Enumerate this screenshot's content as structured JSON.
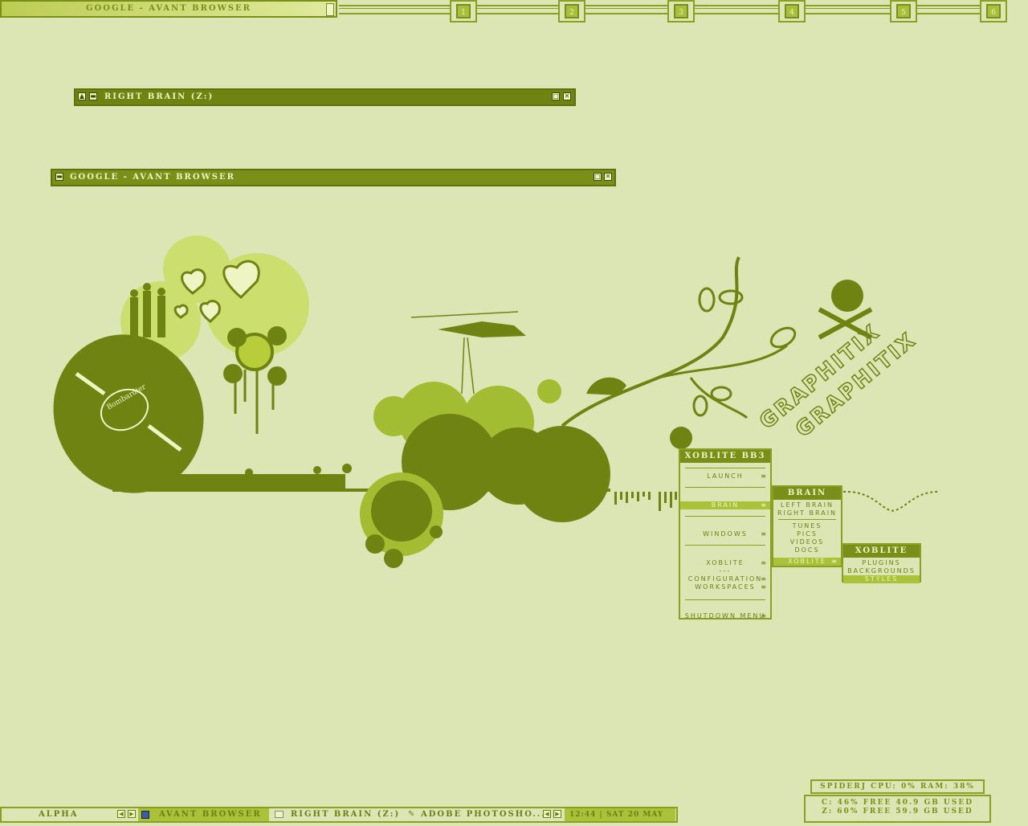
{
  "top_bar": {
    "active_title": "GOOGLE - AVANT BROWSER",
    "workspaces": [
      "1",
      "2",
      "3",
      "4",
      "5",
      "6"
    ]
  },
  "windows": {
    "right_brain": {
      "title": "RIGHT BRAIN (Z:)"
    },
    "google": {
      "title": "GOOGLE - AVANT BROWSER"
    }
  },
  "wallpaper": {
    "text_1": "GRAPHITIX",
    "text_2": "GRAPHITIX",
    "record_label": "Bombardier"
  },
  "main_menu": {
    "title": "XOBLITE BB3",
    "items": [
      "LAUNCH",
      "BRAIN",
      "WINDOWS",
      "XOBLITE",
      "---",
      "CONFIGURATION",
      "WORKSPACES",
      "SHUTDOWN MENU"
    ]
  },
  "brain_menu": {
    "title": "BRAIN",
    "items": [
      "LEFT BRAIN",
      "RIGHT BRAIN",
      "TUNES",
      "PICS",
      "VIDEOS",
      "DOCS",
      "XOBLITE"
    ]
  },
  "xoblite_menu": {
    "title": "XOBLITE",
    "items": [
      "PLUGINS",
      "BACKGROUNDS",
      "STYLES"
    ]
  },
  "taskbar": {
    "workspace_label": "ALPHA",
    "tasks": [
      "AVANT BROWSER",
      "RIGHT BRAIN (Z:)",
      "ADOBE PHOTOSHO..."
    ],
    "clock": "12:44 | SAT 20 MAY"
  },
  "system_monitor": {
    "line1": "SPIDERJ CPU: 0% RAM: 38%",
    "line2": "C: 46% FREE  40.9 GB USED",
    "line3": "Z: 60% FREE  59.9 GB USED"
  },
  "colors": {
    "background": "#dce6b4",
    "accent": "#6e8312",
    "highlight": "#a9c23a"
  }
}
